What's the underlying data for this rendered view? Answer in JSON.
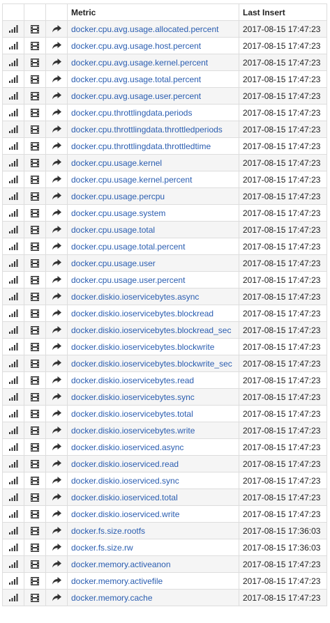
{
  "header": {
    "metric": "Metric",
    "last_insert": "Last Insert"
  },
  "icons": [
    "bar-chart-icon",
    "film-icon",
    "share-arrow-icon"
  ],
  "colors": {
    "link": "#2a5db0",
    "row_alt": "#f5f5f5",
    "border": "#dddddd"
  },
  "rows": [
    {
      "metric": "docker.cpu.avg.usage.allocated.percent",
      "last_insert": "2017-08-15 17:47:23"
    },
    {
      "metric": "docker.cpu.avg.usage.host.percent",
      "last_insert": "2017-08-15 17:47:23"
    },
    {
      "metric": "docker.cpu.avg.usage.kernel.percent",
      "last_insert": "2017-08-15 17:47:23"
    },
    {
      "metric": "docker.cpu.avg.usage.total.percent",
      "last_insert": "2017-08-15 17:47:23"
    },
    {
      "metric": "docker.cpu.avg.usage.user.percent",
      "last_insert": "2017-08-15 17:47:23"
    },
    {
      "metric": "docker.cpu.throttlingdata.periods",
      "last_insert": "2017-08-15 17:47:23"
    },
    {
      "metric": "docker.cpu.throttlingdata.throttledperiods",
      "last_insert": "2017-08-15 17:47:23"
    },
    {
      "metric": "docker.cpu.throttlingdata.throttledtime",
      "last_insert": "2017-08-15 17:47:23"
    },
    {
      "metric": "docker.cpu.usage.kernel",
      "last_insert": "2017-08-15 17:47:23"
    },
    {
      "metric": "docker.cpu.usage.kernel.percent",
      "last_insert": "2017-08-15 17:47:23"
    },
    {
      "metric": "docker.cpu.usage.percpu",
      "last_insert": "2017-08-15 17:47:23"
    },
    {
      "metric": "docker.cpu.usage.system",
      "last_insert": "2017-08-15 17:47:23"
    },
    {
      "metric": "docker.cpu.usage.total",
      "last_insert": "2017-08-15 17:47:23"
    },
    {
      "metric": "docker.cpu.usage.total.percent",
      "last_insert": "2017-08-15 17:47:23"
    },
    {
      "metric": "docker.cpu.usage.user",
      "last_insert": "2017-08-15 17:47:23"
    },
    {
      "metric": "docker.cpu.usage.user.percent",
      "last_insert": "2017-08-15 17:47:23"
    },
    {
      "metric": "docker.diskio.ioservicebytes.async",
      "last_insert": "2017-08-15 17:47:23"
    },
    {
      "metric": "docker.diskio.ioservicebytes.blockread",
      "last_insert": "2017-08-15 17:47:23"
    },
    {
      "metric": "docker.diskio.ioservicebytes.blockread_sec",
      "last_insert": "2017-08-15 17:47:23"
    },
    {
      "metric": "docker.diskio.ioservicebytes.blockwrite",
      "last_insert": "2017-08-15 17:47:23"
    },
    {
      "metric": "docker.diskio.ioservicebytes.blockwrite_sec",
      "last_insert": "2017-08-15 17:47:23"
    },
    {
      "metric": "docker.diskio.ioservicebytes.read",
      "last_insert": "2017-08-15 17:47:23"
    },
    {
      "metric": "docker.diskio.ioservicebytes.sync",
      "last_insert": "2017-08-15 17:47:23"
    },
    {
      "metric": "docker.diskio.ioservicebytes.total",
      "last_insert": "2017-08-15 17:47:23"
    },
    {
      "metric": "docker.diskio.ioservicebytes.write",
      "last_insert": "2017-08-15 17:47:23"
    },
    {
      "metric": "docker.diskio.ioserviced.async",
      "last_insert": "2017-08-15 17:47:23"
    },
    {
      "metric": "docker.diskio.ioserviced.read",
      "last_insert": "2017-08-15 17:47:23"
    },
    {
      "metric": "docker.diskio.ioserviced.sync",
      "last_insert": "2017-08-15 17:47:23"
    },
    {
      "metric": "docker.diskio.ioserviced.total",
      "last_insert": "2017-08-15 17:47:23"
    },
    {
      "metric": "docker.diskio.ioserviced.write",
      "last_insert": "2017-08-15 17:47:23"
    },
    {
      "metric": "docker.fs.size.rootfs",
      "last_insert": "2017-08-15 17:36:03"
    },
    {
      "metric": "docker.fs.size.rw",
      "last_insert": "2017-08-15 17:36:03"
    },
    {
      "metric": "docker.memory.activeanon",
      "last_insert": "2017-08-15 17:47:23"
    },
    {
      "metric": "docker.memory.activefile",
      "last_insert": "2017-08-15 17:47:23"
    },
    {
      "metric": "docker.memory.cache",
      "last_insert": "2017-08-15 17:47:23"
    }
  ]
}
